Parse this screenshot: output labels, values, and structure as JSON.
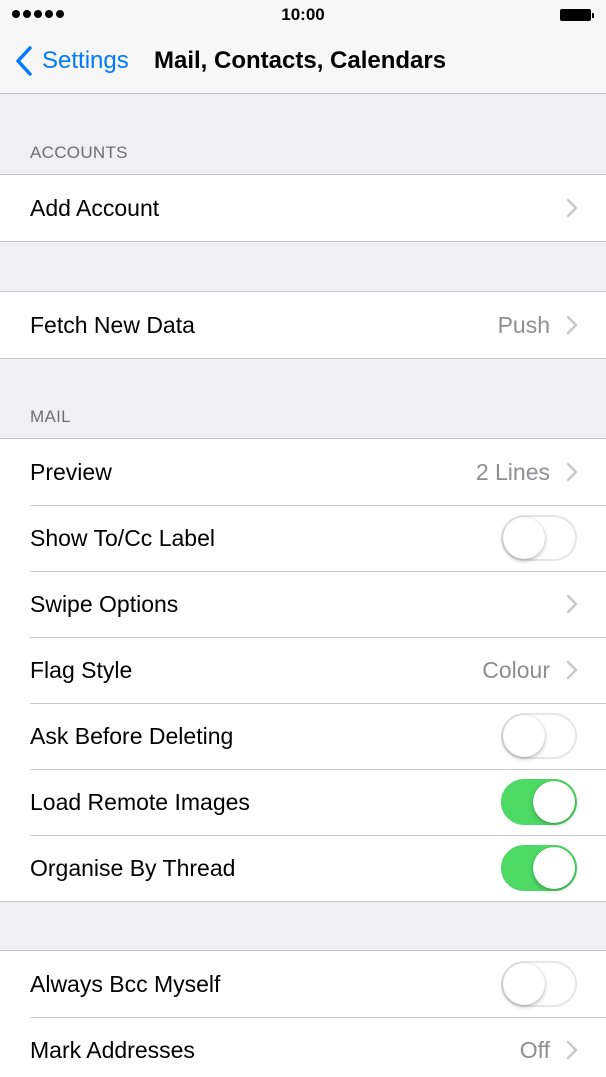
{
  "status_bar": {
    "time": "10:00"
  },
  "nav": {
    "back_label": "Settings",
    "title": "Mail, Contacts, Calendars"
  },
  "sections": {
    "accounts_header": "ACCOUNTS",
    "mail_header": "MAIL"
  },
  "accounts": {
    "add_account": "Add Account"
  },
  "fetch": {
    "label": "Fetch New Data",
    "value": "Push"
  },
  "mail": {
    "preview": {
      "label": "Preview",
      "value": "2 Lines"
    },
    "show_tocc": {
      "label": "Show To/Cc Label",
      "on": false
    },
    "swipe_options": {
      "label": "Swipe Options"
    },
    "flag_style": {
      "label": "Flag Style",
      "value": "Colour"
    },
    "ask_before_deleting": {
      "label": "Ask Before Deleting",
      "on": false
    },
    "load_remote_images": {
      "label": "Load Remote Images",
      "on": true
    },
    "organise_by_thread": {
      "label": "Organise By Thread",
      "on": true
    }
  },
  "compose": {
    "always_bcc": {
      "label": "Always Bcc Myself",
      "on": false
    },
    "mark_addresses": {
      "label": "Mark Addresses",
      "value": "Off"
    }
  },
  "colors": {
    "accent": "#007aff",
    "toggle_on": "#4cd964",
    "background": "#efeff4"
  }
}
